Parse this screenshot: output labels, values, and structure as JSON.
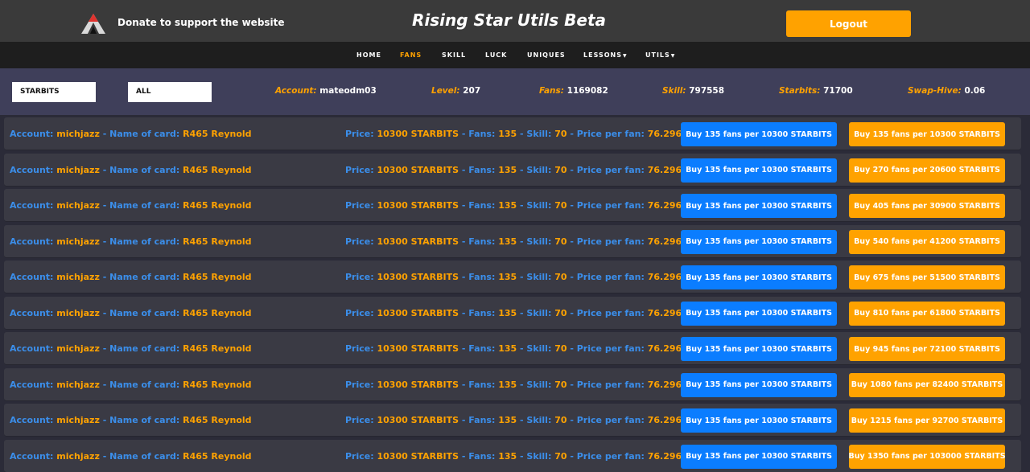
{
  "header": {
    "donate_text": "Donate to support the website",
    "title": "Rising Star Utils Beta",
    "logout_label": "Logout",
    "logo_icon": "mountain-logo-icon"
  },
  "nav": {
    "items": [
      "HOME",
      "FANS",
      "SKILL",
      "LUCK",
      "UNIQUES",
      "LESSONS",
      "UTILS"
    ],
    "active": "FANS"
  },
  "filters": {
    "currency": "STARBITS",
    "scope": "ALL"
  },
  "stats": {
    "account_label": "Account:",
    "account": "mateodm03",
    "level_label": "Level:",
    "level": "207",
    "fans_label": "Fans:",
    "fans": "1169082",
    "skill_label": "Skill:",
    "skill": "797558",
    "starbits_label": "Starbits:",
    "starbits": "71700",
    "swap_label": "Swap-Hive:",
    "swap": "0.06"
  },
  "labels": {
    "account": "Account:",
    "name_of_card": "Name of card:",
    "price": "Price:",
    "fans": "Fans:",
    "skill": "Skill:",
    "price_per_fan": "Price per fan:",
    "sep": " - "
  },
  "listings": [
    {
      "account": "michjazz",
      "card": "R465 Reynold",
      "price": "10300 STARBITS",
      "fans": "135",
      "skill": "70",
      "ppf": "76.296296",
      "buy_one": "Buy 135 fans per 10300 STARBITS",
      "buy_cum": "Buy 135 fans per 10300 STARBITS"
    },
    {
      "account": "michjazz",
      "card": "R465 Reynold",
      "price": "10300 STARBITS",
      "fans": "135",
      "skill": "70",
      "ppf": "76.296296",
      "buy_one": "Buy 135 fans per 10300 STARBITS",
      "buy_cum": "Buy 270 fans per 20600 STARBITS"
    },
    {
      "account": "michjazz",
      "card": "R465 Reynold",
      "price": "10300 STARBITS",
      "fans": "135",
      "skill": "70",
      "ppf": "76.296296",
      "buy_one": "Buy 135 fans per 10300 STARBITS",
      "buy_cum": "Buy 405 fans per 30900 STARBITS"
    },
    {
      "account": "michjazz",
      "card": "R465 Reynold",
      "price": "10300 STARBITS",
      "fans": "135",
      "skill": "70",
      "ppf": "76.296296",
      "buy_one": "Buy 135 fans per 10300 STARBITS",
      "buy_cum": "Buy 540 fans per 41200 STARBITS"
    },
    {
      "account": "michjazz",
      "card": "R465 Reynold",
      "price": "10300 STARBITS",
      "fans": "135",
      "skill": "70",
      "ppf": "76.296296",
      "buy_one": "Buy 135 fans per 10300 STARBITS",
      "buy_cum": "Buy 675 fans per 51500 STARBITS"
    },
    {
      "account": "michjazz",
      "card": "R465 Reynold",
      "price": "10300 STARBITS",
      "fans": "135",
      "skill": "70",
      "ppf": "76.296296",
      "buy_one": "Buy 135 fans per 10300 STARBITS",
      "buy_cum": "Buy 810 fans per 61800 STARBITS"
    },
    {
      "account": "michjazz",
      "card": "R465 Reynold",
      "price": "10300 STARBITS",
      "fans": "135",
      "skill": "70",
      "ppf": "76.296296",
      "buy_one": "Buy 135 fans per 10300 STARBITS",
      "buy_cum": "Buy 945 fans per 72100 STARBITS"
    },
    {
      "account": "michjazz",
      "card": "R465 Reynold",
      "price": "10300 STARBITS",
      "fans": "135",
      "skill": "70",
      "ppf": "76.296296",
      "buy_one": "Buy 135 fans per 10300 STARBITS",
      "buy_cum": "Buy 1080 fans per 82400 STARBITS"
    },
    {
      "account": "michjazz",
      "card": "R465 Reynold",
      "price": "10300 STARBITS",
      "fans": "135",
      "skill": "70",
      "ppf": "76.296296",
      "buy_one": "Buy 135 fans per 10300 STARBITS",
      "buy_cum": "Buy 1215 fans per 92700 STARBITS"
    },
    {
      "account": "michjazz",
      "card": "R465 Reynold",
      "price": "10300 STARBITS",
      "fans": "135",
      "skill": "70",
      "ppf": "76.296296",
      "buy_one": "Buy 135 fans per 10300 STARBITS",
      "buy_cum": "Buy 1350 fans per 103000 STARBITS"
    }
  ],
  "colors": {
    "accent_orange": "#ffa200",
    "accent_blue": "#0b7dff",
    "label_blue": "#3b8eea"
  }
}
